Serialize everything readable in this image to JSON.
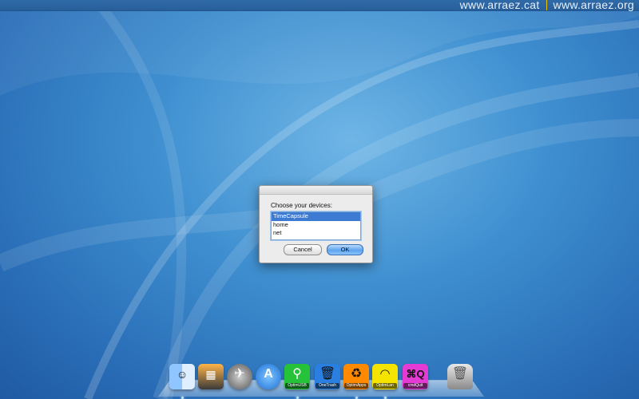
{
  "watermark": {
    "left": "www.arraez.cat",
    "right": "www.arraez.org"
  },
  "dialog": {
    "prompt": "Choose your devices:",
    "items": [
      "TimeCapsule",
      "home",
      "net"
    ],
    "selected_index": 0,
    "cancel_label": "Cancel",
    "ok_label": "OK"
  },
  "dock": {
    "items": [
      {
        "name": "finder-icon",
        "label": ""
      },
      {
        "name": "photo-app-icon",
        "label": ""
      },
      {
        "name": "launchpad-rocket-icon",
        "label": ""
      },
      {
        "name": "app-store-icon",
        "label": ""
      },
      {
        "name": "usb-icon",
        "label": "OptimUSB"
      },
      {
        "name": "trash-can-icon",
        "label": "OneTrash"
      },
      {
        "name": "recycle-icon",
        "label": "OptimApps"
      },
      {
        "name": "wifi-icon",
        "label": "OptimLan"
      },
      {
        "name": "command-q-icon",
        "label": "cmdQuit"
      },
      {
        "name": "trash-bin-icon",
        "label": ""
      }
    ]
  },
  "colors": {
    "accent": "#3d7bd3",
    "desktop": "#3f8fd0"
  }
}
